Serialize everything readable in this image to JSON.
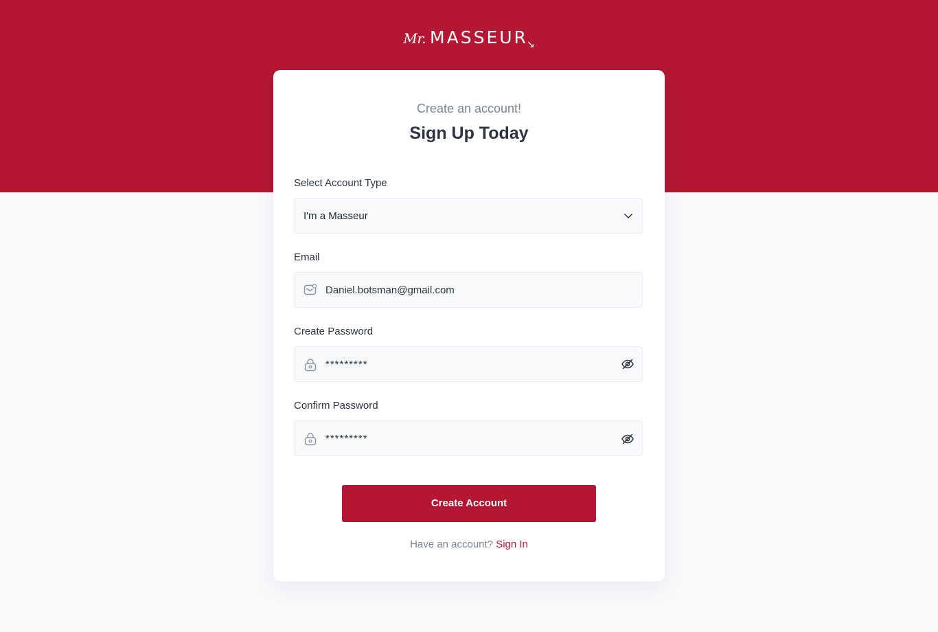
{
  "brand": {
    "prefix": "Mr.",
    "name": "MASSEUR",
    "arrow": "↘"
  },
  "colors": {
    "brand": "#b31733",
    "background": "#f8f9fb",
    "card": "#ffffff",
    "text": "#2d3340",
    "muted": "#7b8496",
    "icon": "#8b93a4"
  },
  "form": {
    "subtitle": "Create an account!",
    "title": "Sign Up Today",
    "account_type": {
      "label": "Select Account Type",
      "value": "I'm a Masseur",
      "icon": "chevron-down-icon"
    },
    "email": {
      "label": "Email",
      "value": "Daniel.botsman@gmail.com",
      "icon": "mail-icon"
    },
    "password": {
      "label": "Create Password",
      "value": "*********",
      "icon": "lock-icon",
      "toggle_icon": "eye-off-icon"
    },
    "confirm_password": {
      "label": "Confirm Password",
      "value": "*********",
      "icon": "lock-icon",
      "toggle_icon": "eye-off-icon"
    },
    "submit_label": "Create Account",
    "footer_text": "Have an account?",
    "footer_link": "Sign In"
  }
}
